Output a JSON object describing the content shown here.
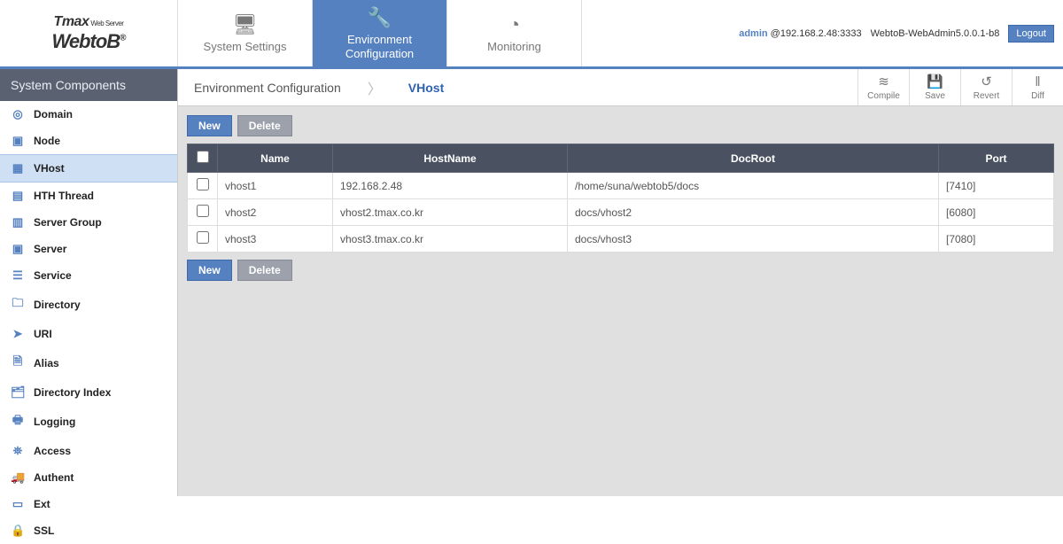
{
  "logo": {
    "brand_top": "Tmax",
    "brand_top_sub": "Web Server",
    "brand_bottom": "WebtoB",
    "reg": "®"
  },
  "header_tabs": [
    {
      "label": "System Settings",
      "icon": "🖥",
      "active": false
    },
    {
      "label": "Environment Configuration",
      "icon": "🔧",
      "active": true
    },
    {
      "label": "Monitoring",
      "icon": "◔",
      "active": false
    }
  ],
  "header_right": {
    "user": "admin",
    "host_prefix": "@",
    "host": "192.168.2.48:3333",
    "version": "WebtoB-WebAdmin5.0.0.1-b8",
    "logout": "Logout"
  },
  "sidebar": {
    "title": "System Components",
    "items": [
      {
        "label": "Domain",
        "icon": "◎",
        "active": false
      },
      {
        "label": "Node",
        "icon": "▣",
        "active": false
      },
      {
        "label": "VHost",
        "icon": "▦",
        "active": true
      },
      {
        "label": "HTH Thread",
        "icon": "▤",
        "active": false
      },
      {
        "label": "Server Group",
        "icon": "▥",
        "active": false
      },
      {
        "label": "Server",
        "icon": "▣",
        "active": false
      },
      {
        "label": "Service",
        "icon": "☰",
        "active": false
      },
      {
        "label": "Directory",
        "icon": "🗀",
        "active": false
      },
      {
        "label": "URI",
        "icon": "➤",
        "active": false
      },
      {
        "label": "Alias",
        "icon": "🗎",
        "active": false
      },
      {
        "label": "Directory Index",
        "icon": "🗂",
        "active": false
      },
      {
        "label": "Logging",
        "icon": "🖶",
        "active": false
      },
      {
        "label": "Access",
        "icon": "⛯",
        "active": false
      },
      {
        "label": "Authent",
        "icon": "🚚",
        "active": false
      },
      {
        "label": "Ext",
        "icon": "▭",
        "active": false
      },
      {
        "label": "SSL",
        "icon": "🔒",
        "active": false
      }
    ]
  },
  "breadcrumb": {
    "crumb1": "Environment Configuration",
    "crumb2": "VHost"
  },
  "toolbar": [
    {
      "label": "Compile",
      "icon": "≋"
    },
    {
      "label": "Save",
      "icon": "💾"
    },
    {
      "label": "Revert",
      "icon": "↺"
    },
    {
      "label": "Diff",
      "icon": "‖"
    }
  ],
  "actions": {
    "new": "New",
    "delete": "Delete"
  },
  "table": {
    "headers": {
      "name": "Name",
      "hostname": "HostName",
      "docroot": "DocRoot",
      "port": "Port"
    },
    "rows": [
      {
        "name": "vhost1",
        "hostname": "192.168.2.48",
        "docroot": "/home/suna/webtob5/docs",
        "port": "[7410]"
      },
      {
        "name": "vhost2",
        "hostname": "vhost2.tmax.co.kr",
        "docroot": "docs/vhost2",
        "port": "[6080]"
      },
      {
        "name": "vhost3",
        "hostname": "vhost3.tmax.co.kr",
        "docroot": "docs/vhost3",
        "port": "[7080]"
      }
    ]
  }
}
